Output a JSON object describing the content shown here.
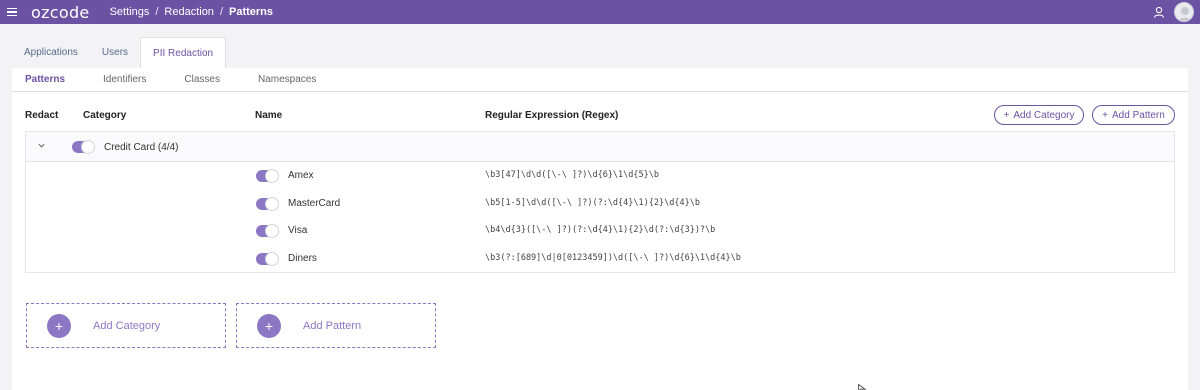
{
  "app": {
    "logo": "ozcode"
  },
  "breadcrumb": [
    "Settings",
    "Redaction",
    "Patterns"
  ],
  "tabs": [
    {
      "label": "Applications",
      "active": false
    },
    {
      "label": "Users",
      "active": false
    },
    {
      "label": "PII Redaction",
      "active": true
    }
  ],
  "subtabs": [
    {
      "label": "Patterns",
      "active": true
    },
    {
      "label": "Identifiers",
      "active": false
    },
    {
      "label": "Classes",
      "active": false
    },
    {
      "label": "Namespaces",
      "active": false
    }
  ],
  "table": {
    "columns": [
      "Redact",
      "Category",
      "Name",
      "Regular Expression (Regex)"
    ],
    "add_category_label": "Add Category",
    "add_pattern_label": "Add Pattern",
    "category": {
      "label": "Credit Card (4/4)",
      "enabled": true,
      "expanded": true
    },
    "patterns": [
      {
        "name": "Amex",
        "regex": "\\b3[47]\\d\\d([\\-\\ ]?)\\d{6}\\1\\d{5}\\b",
        "enabled": true
      },
      {
        "name": "MasterCard",
        "regex": "\\b5[1-5]\\d\\d([\\-\\ ]?)(?:\\d{4}\\1){2}\\d{4}\\b",
        "enabled": true
      },
      {
        "name": "Visa",
        "regex": "\\b4\\d{3}([\\-\\ ]?)(?:\\d{4}\\1){2}\\d(?:\\d{3})?\\b",
        "enabled": true
      },
      {
        "name": "Diners",
        "regex": "\\b3(?:[689]\\d|0[0123459])\\d([\\-\\ ]?)\\d{6}\\1\\d{4}\\b",
        "enabled": true
      }
    ]
  },
  "cards": {
    "add_category": "Add Category",
    "add_pattern": "Add Pattern"
  },
  "colors": {
    "brand": "#6b52a3",
    "accent": "#8c77c4"
  }
}
